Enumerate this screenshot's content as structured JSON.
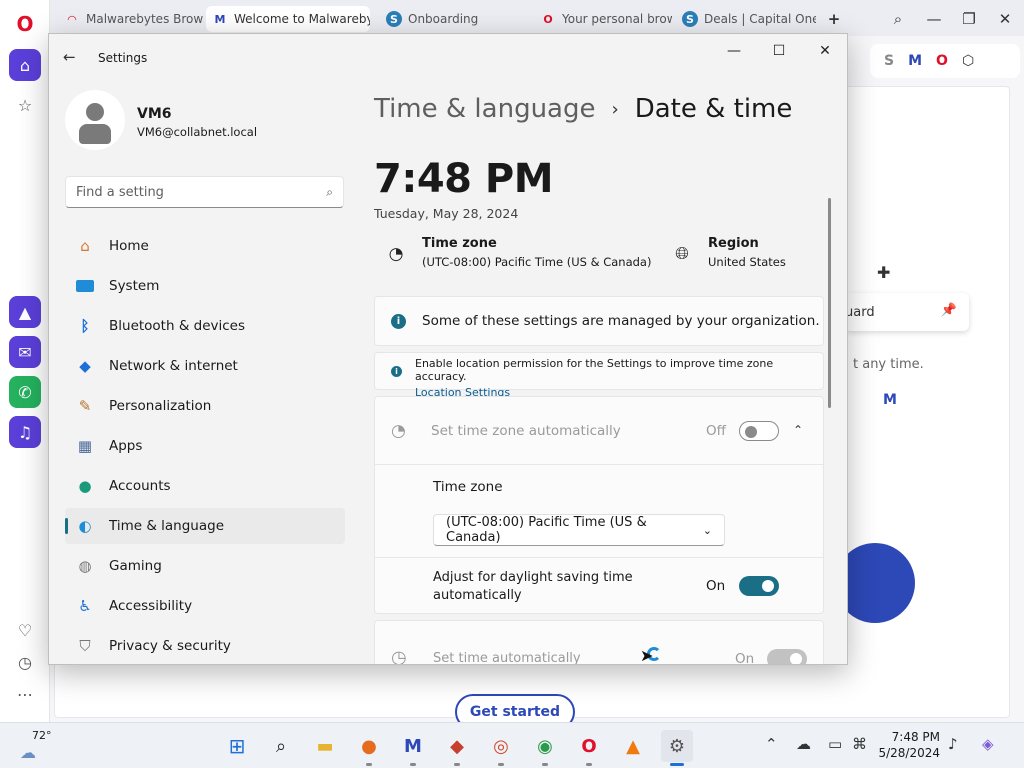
{
  "browser": {
    "tabs": [
      {
        "title": "Malwarebytes Brows",
        "icon": "opera-rainbow-icon"
      },
      {
        "title": "Welcome to Malwarebyte",
        "icon": "malwarebytes-icon"
      },
      {
        "title": "Onboarding",
        "icon": "s-logo-icon"
      },
      {
        "title": "Your personal brows",
        "icon": "opera-icon"
      },
      {
        "title": "Deals | Capital One",
        "icon": "s-logo-icon"
      }
    ],
    "new_tab": "+",
    "page_fragments": {
      "guard": "uard",
      "any_time": "t any time."
    },
    "get_started": "Get started"
  },
  "settings": {
    "app_title": "Settings",
    "user": {
      "name": "VM6",
      "email": "VM6@collabnet.local"
    },
    "search_placeholder": "Find a setting",
    "nav": [
      {
        "label": "Home",
        "icon": "home-icon"
      },
      {
        "label": "System",
        "icon": "system-icon"
      },
      {
        "label": "Bluetooth & devices",
        "icon": "bluetooth-icon"
      },
      {
        "label": "Network & internet",
        "icon": "wifi-icon"
      },
      {
        "label": "Personalization",
        "icon": "brush-icon"
      },
      {
        "label": "Apps",
        "icon": "apps-icon"
      },
      {
        "label": "Accounts",
        "icon": "accounts-icon"
      },
      {
        "label": "Time & language",
        "icon": "globe-clock-icon",
        "selected": true
      },
      {
        "label": "Gaming",
        "icon": "gamepad-icon"
      },
      {
        "label": "Accessibility",
        "icon": "accessibility-icon"
      },
      {
        "label": "Privacy & security",
        "icon": "shield-icon"
      }
    ],
    "breadcrumb": {
      "parent": "Time & language",
      "separator": "›",
      "current": "Date & time"
    },
    "time": "7:48 PM",
    "date": "Tuesday, May 28, 2024",
    "time_zone": {
      "title": "Time zone",
      "value": "(UTC-08:00) Pacific Time (US & Canada)"
    },
    "region": {
      "title": "Region",
      "value": "United States"
    },
    "managed_notice": "Some of these settings are managed by your organization.",
    "location_notice": {
      "text": "Enable location permission for the Settings to improve time zone accuracy.",
      "link": "Location Settings"
    },
    "set_tz_auto": {
      "label": "Set time zone automatically",
      "state": "Off"
    },
    "tz_select": {
      "label": "Time zone",
      "value": "(UTC-08:00) Pacific Time (US & Canada)"
    },
    "dst": {
      "label": "Adjust for daylight saving time automatically",
      "state": "On"
    },
    "set_time_auto": {
      "label": "Set time automatically",
      "state": "On"
    }
  },
  "taskbar": {
    "weather": "72°",
    "clock_time": "7:48 PM",
    "clock_date": "5/28/2024"
  },
  "colors": {
    "accent": "#1a6f87",
    "opera_red": "#e0102a",
    "malwarebytes_blue": "#2d48b7"
  }
}
